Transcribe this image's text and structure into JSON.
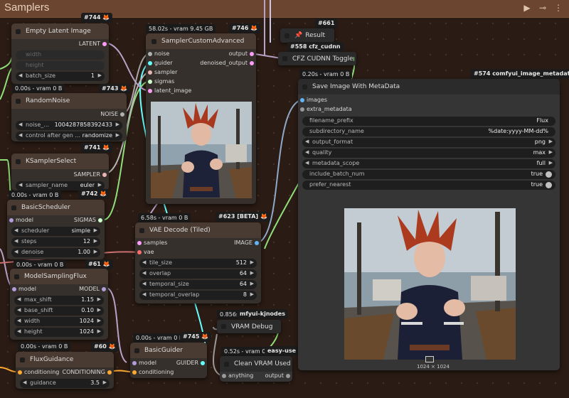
{
  "group": {
    "title": "Samplers"
  },
  "colors": {
    "latent": "#ff9cf9",
    "noise": "#b0b0b0",
    "sampler": "#ecb4b4",
    "sigmas": "#cdffcd",
    "guider": "#66ffff",
    "model": "#b39ddb",
    "vae": "#ff6e6e",
    "image": "#64b5f6",
    "conditioning": "#ffa931",
    "any": "#9a9a9a",
    "wire_green": "#8fe07a",
    "wire_pink": "#b7a2c8",
    "wire_light": "#c8c8e8"
  },
  "badges": {
    "b744": "#744",
    "b743": "#743",
    "b741": "#741",
    "b742": "#742",
    "b61": "#61",
    "b60": "#60",
    "b746": "#746",
    "b623": "#623 [BETA]",
    "b745": "#745",
    "b661": "#661",
    "b558": "#558 cfz_cudnn",
    "b574": "#574 comfyui_image_metadata_...",
    "kjnodes": "mfyui-kjnodes",
    "easyuse": "easy-use"
  },
  "timings": {
    "random_noise": "0.00s - vram 0 B",
    "ksampler_select": "0.00s - vram 0 B",
    "model_sampling": "0.00s - vram 0 B",
    "flux_guidance": "0.00s - vram 0 B",
    "sampler_custom": "58.02s - vram 9.45 GB",
    "vae_decode": "6.58s - vram 0 B",
    "basic_guider": "0.00s - vram 0 B",
    "vram_debug": "0.856s",
    "clean_vram": "0.52s - vram 0 B",
    "save_image": "0.20s - vram 0 B"
  },
  "nodes": {
    "empty_latent": {
      "title": "Empty Latent Image",
      "out": "LATENT",
      "width_label": "width",
      "height_label": "height",
      "batch_label": "batch_size",
      "batch_value": "1"
    },
    "random_noise": {
      "title": "RandomNoise",
      "out": "NOISE",
      "noise_label": "noise_...",
      "noise_value": "1004287858392433",
      "control_label": "control after gen ...",
      "control_value": "randomize"
    },
    "ksampler_select": {
      "title": "KSamplerSelect",
      "out": "SAMPLER",
      "sampler_label": "sampler_name",
      "sampler_value": "euler"
    },
    "basic_scheduler": {
      "title": "BasicScheduler",
      "in_model": "model",
      "out": "SIGMAS",
      "scheduler_label": "scheduler",
      "scheduler_value": "simple",
      "steps_label": "steps",
      "steps_value": "12",
      "denoise_label": "denoise",
      "denoise_value": "1.00"
    },
    "model_sampling": {
      "title": "ModelSamplingFlux",
      "in_model": "model",
      "out": "MODEL",
      "max_shift_label": "max_shift",
      "max_shift_value": "1.15",
      "base_shift_label": "base_shift",
      "base_shift_value": "0.10",
      "width_label": "width",
      "width_value": "1024",
      "height_label": "height",
      "height_value": "1024"
    },
    "flux_guidance": {
      "title": "FluxGuidance",
      "in": "conditioning",
      "out": "CONDITIONING",
      "guidance_label": "guidance",
      "guidance_value": "3.5"
    },
    "sampler_custom": {
      "title": "SamplerCustomAdvanced",
      "in_noise": "noise",
      "in_guider": "guider",
      "in_sampler": "sampler",
      "in_sigmas": "sigmas",
      "in_latent": "latent_image",
      "out_output": "output",
      "out_denoised": "denoised_output"
    },
    "vae_decode": {
      "title": "VAE Decode (Tiled)",
      "in_samples": "samples",
      "in_vae": "vae",
      "out": "IMAGE",
      "tile_label": "tile_size",
      "tile_value": "512",
      "overlap_label": "overlap",
      "overlap_value": "64",
      "tsize_label": "temporal_size",
      "tsize_value": "64",
      "toverlap_label": "temporal_overlap",
      "toverlap_value": "8"
    },
    "basic_guider": {
      "title": "BasicGuider",
      "in_model": "model",
      "in_cond": "conditioning",
      "out": "GUIDER"
    },
    "result": {
      "title": "Result"
    },
    "cfz_toggle": {
      "title": "CFZ CUDNN Toggle"
    },
    "vram_debug": {
      "title": "VRAM Debug"
    },
    "clean_vram": {
      "title": "Clean VRAM Used",
      "in": "anything",
      "out": "output"
    },
    "save_image": {
      "title": "Save Image With MetaData",
      "in_images": "images",
      "in_extra": "extra_metadata",
      "filename_label": "filename_prefix",
      "filename_value": "Flux",
      "subdir_label": "subdirectory_name",
      "subdir_value": "%date:yyyy-MM-dd%",
      "format_label": "output_format",
      "format_value": "png",
      "quality_label": "quality",
      "quality_value": "max",
      "scope_label": "metadata_scope",
      "scope_value": "full",
      "batch_label": "include_batch_num",
      "batch_value": "true",
      "nearest_label": "prefer_nearest",
      "nearest_value": "true",
      "image_size": "1024 × 1024"
    }
  }
}
